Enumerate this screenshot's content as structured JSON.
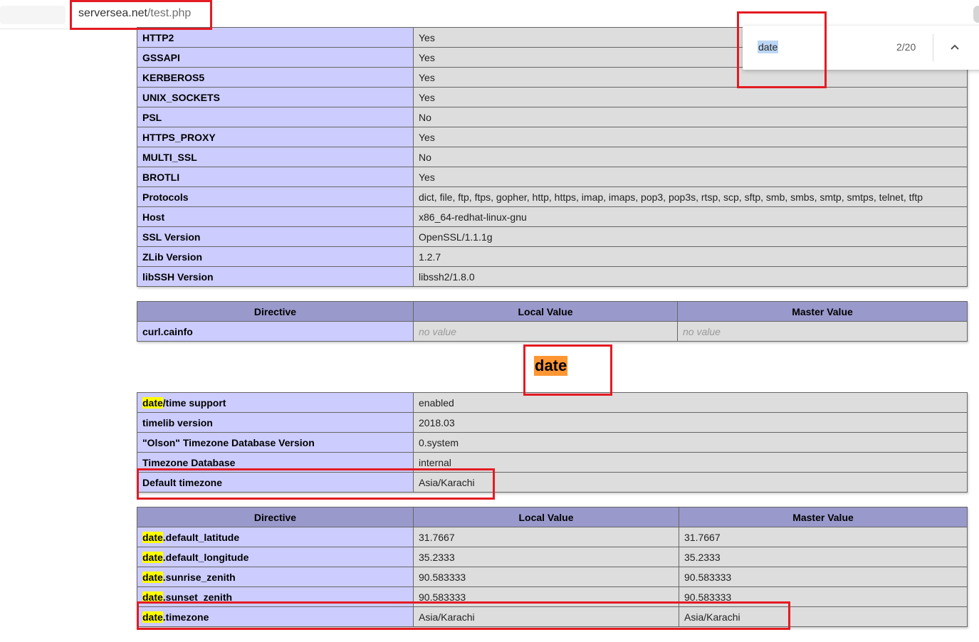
{
  "browser": {
    "url_host": "serversea.net",
    "url_path": "/test.php"
  },
  "find": {
    "query": "date",
    "count": "2/20"
  },
  "curl_rows": [
    {
      "name": "HTTP2",
      "value": "Yes"
    },
    {
      "name": "GSSAPI",
      "value": "Yes"
    },
    {
      "name": "KERBEROS5",
      "value": "Yes"
    },
    {
      "name": "UNIX_SOCKETS",
      "value": "Yes"
    },
    {
      "name": "PSL",
      "value": "No"
    },
    {
      "name": "HTTPS_PROXY",
      "value": "Yes"
    },
    {
      "name": "MULTI_SSL",
      "value": "No"
    },
    {
      "name": "BROTLI",
      "value": "Yes"
    },
    {
      "name": "Protocols",
      "value": "dict, file, ftp, ftps, gopher, http, https, imap, imaps, pop3, pop3s, rtsp, scp, sftp, smb, smbs, smtp, smtps, telnet, tftp"
    },
    {
      "name": "Host",
      "value": "x86_64-redhat-linux-gnu"
    },
    {
      "name": "SSL Version",
      "value": "OpenSSL/1.1.1g"
    },
    {
      "name": "ZLib Version",
      "value": "1.2.7"
    },
    {
      "name": "libSSH Version",
      "value": "libssh2/1.8.0"
    }
  ],
  "curl_directives": {
    "headers": [
      "Directive",
      "Local Value",
      "Master Value"
    ],
    "rows": [
      {
        "name": "curl.cainfo",
        "local": "no value",
        "master": "no value"
      }
    ]
  },
  "date_section": {
    "title": "date",
    "info_rows": [
      {
        "hl": "date",
        "rest": "/time support",
        "value": "enabled"
      },
      {
        "hl": "",
        "rest": "timelib version",
        "value": "2018.03"
      },
      {
        "hl": "",
        "rest": "\"Olson\" Timezone Database Version",
        "value": "0.system"
      },
      {
        "hl": "",
        "rest": "Timezone Database",
        "value": "internal"
      },
      {
        "hl": "",
        "rest": "Default timezone",
        "value": "Asia/Karachi"
      }
    ],
    "directive_headers": [
      "Directive",
      "Local Value",
      "Master Value"
    ],
    "directives": [
      {
        "hl": "date",
        "rest": ".default_latitude",
        "local": "31.7667",
        "master": "31.7667"
      },
      {
        "hl": "date",
        "rest": ".default_longitude",
        "local": "35.2333",
        "master": "35.2333"
      },
      {
        "hl": "date",
        "rest": ".sunrise_zenith",
        "local": "90.583333",
        "master": "90.583333"
      },
      {
        "hl": "date",
        "rest": ".sunset_zenith",
        "local": "90.583333",
        "master": "90.583333"
      },
      {
        "hl": "date",
        "rest": ".timezone",
        "local": "Asia/Karachi",
        "master": "Asia/Karachi"
      }
    ]
  },
  "colors": {
    "key_cell": "#ccccff",
    "value_cell": "#dddddd",
    "header_cell": "#9999cc",
    "find_highlight": "#ffff00",
    "active_match": "#ff9632",
    "annotation": "#e41b23"
  }
}
